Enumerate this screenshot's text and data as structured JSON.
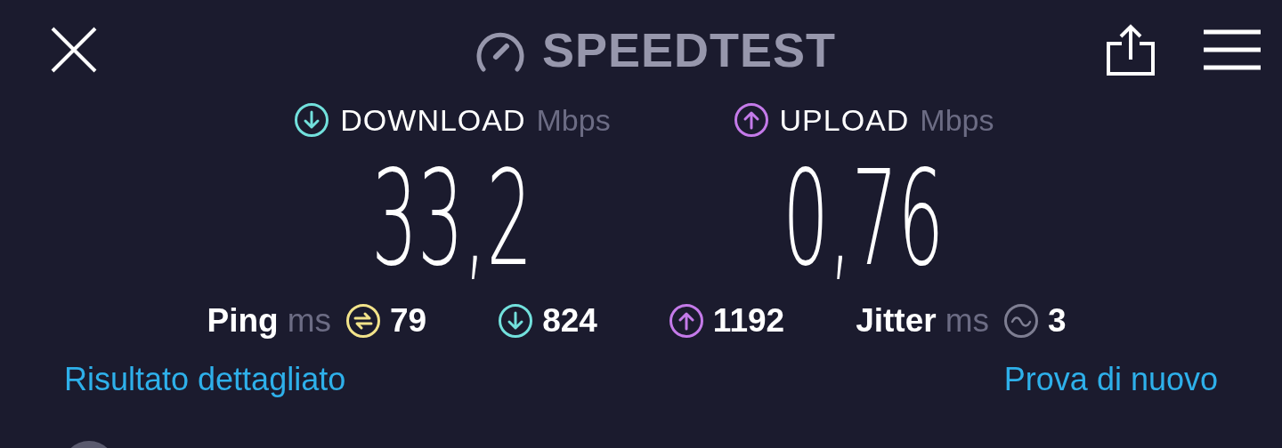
{
  "header": {
    "title": "SPEEDTEST"
  },
  "metrics": [
    {
      "kind": "download",
      "label": "DOWNLOAD",
      "unit": "Mbps",
      "value": "33,2"
    },
    {
      "kind": "upload",
      "label": "UPLOAD",
      "unit": "Mbps",
      "value": "0,76"
    }
  ],
  "stats": [
    {
      "kind": "ping",
      "label": "Ping",
      "unit": "ms",
      "value": "79"
    },
    {
      "kind": "download",
      "value": "824"
    },
    {
      "kind": "upload",
      "value": "1192"
    },
    {
      "kind": "jitter",
      "label": "Jitter",
      "unit": "ms",
      "value": "3"
    }
  ],
  "links": [
    {
      "label": "Risultato dettagliato"
    },
    {
      "label": "Prova di nuovo"
    }
  ]
}
